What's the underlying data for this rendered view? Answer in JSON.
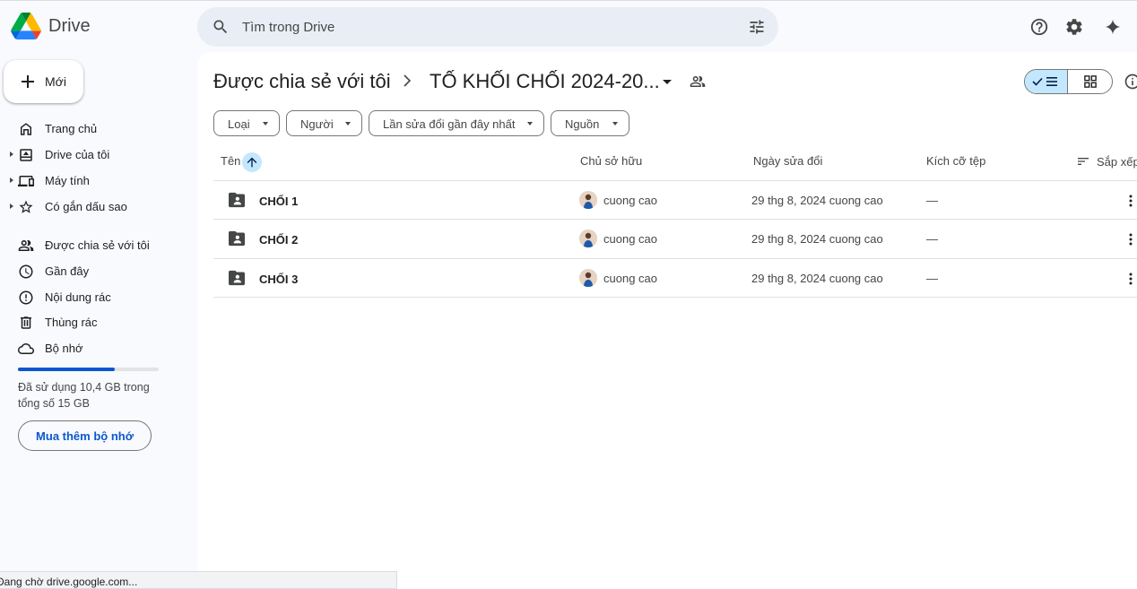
{
  "app": {
    "name": "Drive"
  },
  "search": {
    "placeholder": "Tìm trong Drive"
  },
  "sidebar": {
    "new_label": "Mới",
    "items": [
      {
        "label": "Trang chủ",
        "icon": "home-icon"
      },
      {
        "label": "Drive của tôi",
        "icon": "my-drive-icon"
      },
      {
        "label": "Máy tính",
        "icon": "computers-icon"
      },
      {
        "label": "Có gắn dấu sao",
        "icon": "star-icon"
      },
      {
        "label": "Được chia sẻ với tôi",
        "icon": "shared-people-icon"
      },
      {
        "label": "Gần đây",
        "icon": "clock-icon"
      },
      {
        "label": "Nội dung rác",
        "icon": "spam-icon"
      },
      {
        "label": "Thùng rác",
        "icon": "trash-icon"
      },
      {
        "label": "Bộ nhớ",
        "icon": "cloud-icon"
      }
    ],
    "storage": {
      "used_fraction": 0.69,
      "text": "Đã sử dụng 10,4 GB trong tổng số 15 GB",
      "buy_label": "Mua thêm bộ nhớ",
      "bar_color": "#0b57d0"
    }
  },
  "breadcrumb": {
    "parent": "Được chia sẻ với tôi",
    "current": "TỐ KHỐI CHỐI 2024-20..."
  },
  "filters": [
    {
      "label": "Loại"
    },
    {
      "label": "Người"
    },
    {
      "label": "Lần sửa đổi gần đây nhất"
    },
    {
      "label": "Nguồn"
    }
  ],
  "table": {
    "columns": {
      "name": "Tên",
      "owner": "Chủ sở hữu",
      "modified": "Ngày sửa đổi",
      "size": "Kích cỡ tệp",
      "sort": "Sắp xếp"
    },
    "rows": [
      {
        "name": "CHỐI 1",
        "owner": "cuong cao",
        "modified": "29 thg 8, 2024 cuong cao",
        "size": "—"
      },
      {
        "name": "CHỐI 2",
        "owner": "cuong cao",
        "modified": "29 thg 8, 2024 cuong cao",
        "size": "—"
      },
      {
        "name": "CHỐI 3",
        "owner": "cuong cao",
        "modified": "29 thg 8, 2024 cuong cao",
        "size": "—"
      }
    ]
  },
  "status_bar": {
    "text": "Đang chờ drive.google.com..."
  },
  "colors": {
    "accent": "#0b57d0",
    "selected": "#c2e7ff",
    "search_bg": "#e9eef6"
  }
}
